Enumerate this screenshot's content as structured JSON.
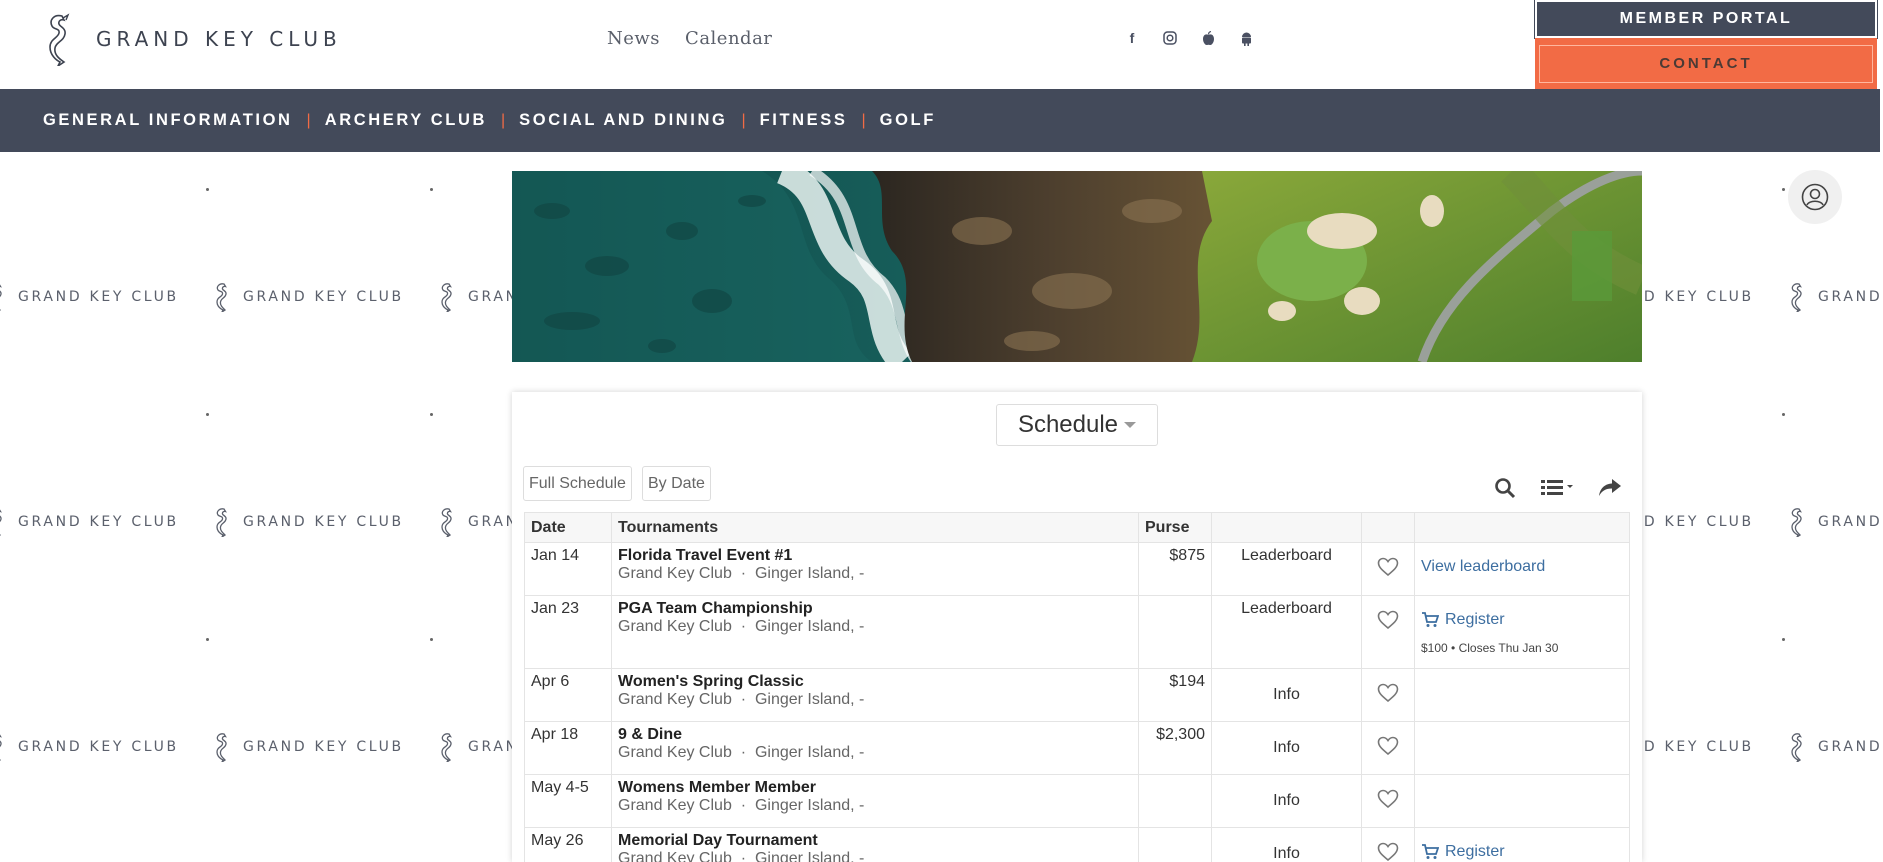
{
  "brand": {
    "name": "GRAND KEY CLUB"
  },
  "toplinks": [
    "News",
    "Calendar"
  ],
  "social_icons": [
    "facebook-icon",
    "instagram-icon",
    "apple-icon",
    "android-icon"
  ],
  "portal": {
    "member_portal": "MEMBER PORTAL",
    "contact": "CONTACT"
  },
  "nav": [
    "GENERAL INFORMATION",
    "ARCHERY CLUB",
    "SOCIAL AND DINING",
    "FITNESS",
    "GOLF"
  ],
  "watermark": "GRAND KEY CLUB",
  "schedule": {
    "selector": "Schedule",
    "tabs": [
      "Full Schedule",
      "By Date"
    ],
    "columns": [
      "Date",
      "Tournaments",
      "Purse",
      "",
      "",
      ""
    ],
    "rows": [
      {
        "date": "Jan 14",
        "name": "Florida Travel Event #1",
        "venue": "Grand Key Club",
        "location": "Ginger Island, -",
        "purse": "$875",
        "status": "Leaderboard",
        "action": "View leaderboard",
        "note": ""
      },
      {
        "date": "Jan 23",
        "name": "PGA Team Championship",
        "venue": "Grand Key Club",
        "location": "Ginger Island, -",
        "purse": "",
        "status": "Leaderboard",
        "action": "Register",
        "note": "$100 • Closes Thu Jan 30"
      },
      {
        "date": "Apr 6",
        "name": "Women's Spring Classic",
        "venue": "Grand Key Club",
        "location": "Ginger Island, -",
        "purse": "$194",
        "status": "Info",
        "action": "",
        "note": ""
      },
      {
        "date": "Apr 18",
        "name": "9 & Dine",
        "venue": "Grand Key Club",
        "location": "Ginger Island, -",
        "purse": "$2,300",
        "status": "Info",
        "action": "",
        "note": ""
      },
      {
        "date": "May 4-5",
        "name": "Womens Member Member",
        "venue": "Grand Key Club",
        "location": "Ginger Island, -",
        "purse": "",
        "status": "Info",
        "action": "",
        "note": ""
      },
      {
        "date": "May 26",
        "name": "Memorial Day Tournament",
        "venue": "Grand Key Club",
        "location": "Ginger Island, -",
        "purse": "",
        "status": "Info",
        "action": "Register",
        "note": ""
      }
    ]
  },
  "colors": {
    "navy": "#434a5a",
    "accent": "#f26b45",
    "link": "#3d6ea0"
  }
}
